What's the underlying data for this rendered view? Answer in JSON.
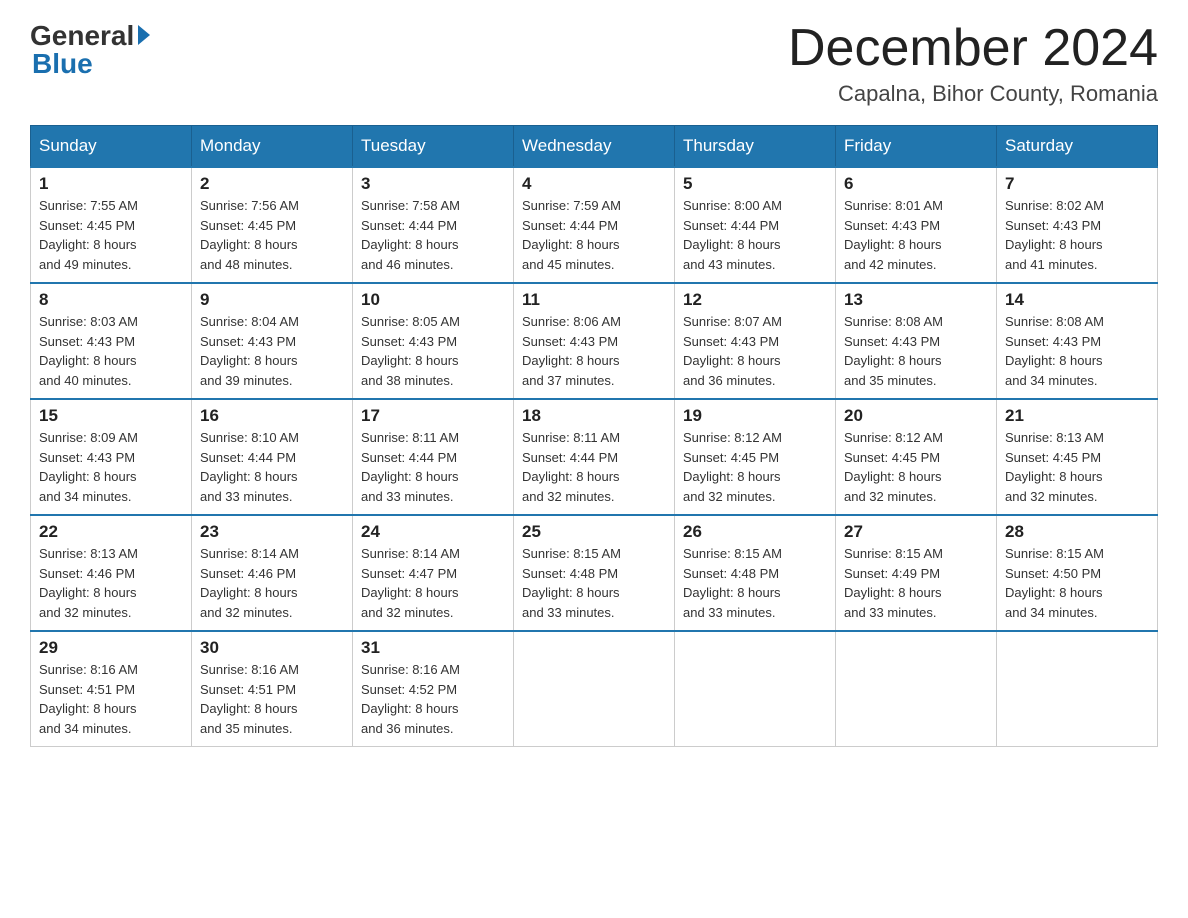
{
  "header": {
    "logo_general": "General",
    "logo_blue": "Blue",
    "month_year": "December 2024",
    "location": "Capalna, Bihor County, Romania"
  },
  "days_of_week": [
    "Sunday",
    "Monday",
    "Tuesday",
    "Wednesday",
    "Thursday",
    "Friday",
    "Saturday"
  ],
  "weeks": [
    [
      {
        "day": "1",
        "sunrise": "7:55 AM",
        "sunset": "4:45 PM",
        "daylight": "8 hours and 49 minutes."
      },
      {
        "day": "2",
        "sunrise": "7:56 AM",
        "sunset": "4:45 PM",
        "daylight": "8 hours and 48 minutes."
      },
      {
        "day": "3",
        "sunrise": "7:58 AM",
        "sunset": "4:44 PM",
        "daylight": "8 hours and 46 minutes."
      },
      {
        "day": "4",
        "sunrise": "7:59 AM",
        "sunset": "4:44 PM",
        "daylight": "8 hours and 45 minutes."
      },
      {
        "day": "5",
        "sunrise": "8:00 AM",
        "sunset": "4:44 PM",
        "daylight": "8 hours and 43 minutes."
      },
      {
        "day": "6",
        "sunrise": "8:01 AM",
        "sunset": "4:43 PM",
        "daylight": "8 hours and 42 minutes."
      },
      {
        "day": "7",
        "sunrise": "8:02 AM",
        "sunset": "4:43 PM",
        "daylight": "8 hours and 41 minutes."
      }
    ],
    [
      {
        "day": "8",
        "sunrise": "8:03 AM",
        "sunset": "4:43 PM",
        "daylight": "8 hours and 40 minutes."
      },
      {
        "day": "9",
        "sunrise": "8:04 AM",
        "sunset": "4:43 PM",
        "daylight": "8 hours and 39 minutes."
      },
      {
        "day": "10",
        "sunrise": "8:05 AM",
        "sunset": "4:43 PM",
        "daylight": "8 hours and 38 minutes."
      },
      {
        "day": "11",
        "sunrise": "8:06 AM",
        "sunset": "4:43 PM",
        "daylight": "8 hours and 37 minutes."
      },
      {
        "day": "12",
        "sunrise": "8:07 AM",
        "sunset": "4:43 PM",
        "daylight": "8 hours and 36 minutes."
      },
      {
        "day": "13",
        "sunrise": "8:08 AM",
        "sunset": "4:43 PM",
        "daylight": "8 hours and 35 minutes."
      },
      {
        "day": "14",
        "sunrise": "8:08 AM",
        "sunset": "4:43 PM",
        "daylight": "8 hours and 34 minutes."
      }
    ],
    [
      {
        "day": "15",
        "sunrise": "8:09 AM",
        "sunset": "4:43 PM",
        "daylight": "8 hours and 34 minutes."
      },
      {
        "day": "16",
        "sunrise": "8:10 AM",
        "sunset": "4:44 PM",
        "daylight": "8 hours and 33 minutes."
      },
      {
        "day": "17",
        "sunrise": "8:11 AM",
        "sunset": "4:44 PM",
        "daylight": "8 hours and 33 minutes."
      },
      {
        "day": "18",
        "sunrise": "8:11 AM",
        "sunset": "4:44 PM",
        "daylight": "8 hours and 32 minutes."
      },
      {
        "day": "19",
        "sunrise": "8:12 AM",
        "sunset": "4:45 PM",
        "daylight": "8 hours and 32 minutes."
      },
      {
        "day": "20",
        "sunrise": "8:12 AM",
        "sunset": "4:45 PM",
        "daylight": "8 hours and 32 minutes."
      },
      {
        "day": "21",
        "sunrise": "8:13 AM",
        "sunset": "4:45 PM",
        "daylight": "8 hours and 32 minutes."
      }
    ],
    [
      {
        "day": "22",
        "sunrise": "8:13 AM",
        "sunset": "4:46 PM",
        "daylight": "8 hours and 32 minutes."
      },
      {
        "day": "23",
        "sunrise": "8:14 AM",
        "sunset": "4:46 PM",
        "daylight": "8 hours and 32 minutes."
      },
      {
        "day": "24",
        "sunrise": "8:14 AM",
        "sunset": "4:47 PM",
        "daylight": "8 hours and 32 minutes."
      },
      {
        "day": "25",
        "sunrise": "8:15 AM",
        "sunset": "4:48 PM",
        "daylight": "8 hours and 33 minutes."
      },
      {
        "day": "26",
        "sunrise": "8:15 AM",
        "sunset": "4:48 PM",
        "daylight": "8 hours and 33 minutes."
      },
      {
        "day": "27",
        "sunrise": "8:15 AM",
        "sunset": "4:49 PM",
        "daylight": "8 hours and 33 minutes."
      },
      {
        "day": "28",
        "sunrise": "8:15 AM",
        "sunset": "4:50 PM",
        "daylight": "8 hours and 34 minutes."
      }
    ],
    [
      {
        "day": "29",
        "sunrise": "8:16 AM",
        "sunset": "4:51 PM",
        "daylight": "8 hours and 34 minutes."
      },
      {
        "day": "30",
        "sunrise": "8:16 AM",
        "sunset": "4:51 PM",
        "daylight": "8 hours and 35 minutes."
      },
      {
        "day": "31",
        "sunrise": "8:16 AM",
        "sunset": "4:52 PM",
        "daylight": "8 hours and 36 minutes."
      },
      null,
      null,
      null,
      null
    ]
  ],
  "labels": {
    "sunrise_prefix": "Sunrise: ",
    "sunset_prefix": "Sunset: ",
    "daylight_prefix": "Daylight: "
  }
}
